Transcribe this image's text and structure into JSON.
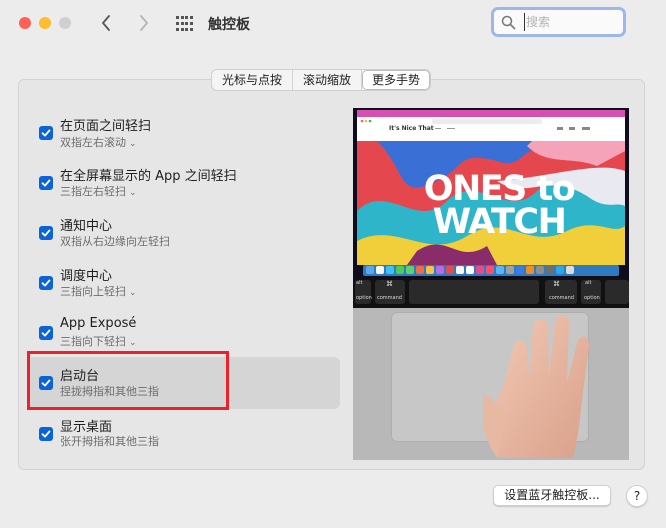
{
  "window": {
    "title": "触控板",
    "back_icon": "chevron-left",
    "forward_icon": "chevron-right",
    "grid_icon": "show-all-grid"
  },
  "search": {
    "placeholder": "搜索",
    "value": ""
  },
  "tabs": [
    {
      "label": "光标与点按",
      "active": false
    },
    {
      "label": "滚动缩放",
      "active": false
    },
    {
      "label": "更多手势",
      "active": true
    }
  ],
  "options": [
    {
      "title": "在页面之间轻扫",
      "subtitle": "双指左右滚动",
      "checked": true,
      "has_menu": true,
      "selected": false
    },
    {
      "title": "在全屏幕显示的 App 之间轻扫",
      "subtitle": "三指左右轻扫",
      "checked": true,
      "has_menu": true,
      "selected": false
    },
    {
      "title": "通知中心",
      "subtitle": "双指从右边缘向左轻扫",
      "checked": true,
      "has_menu": false,
      "selected": false
    },
    {
      "title": "调度中心",
      "subtitle": "三指向上轻扫",
      "checked": true,
      "has_menu": true,
      "selected": false
    },
    {
      "title": "App Exposé",
      "subtitle": "三指向下轻扫",
      "checked": true,
      "has_menu": true,
      "selected": false
    },
    {
      "title": "启动台",
      "subtitle": "捏拢拇指和其他三指",
      "checked": true,
      "has_menu": false,
      "selected": true
    },
    {
      "title": "显示桌面",
      "subtitle": "张开拇指和其他三指",
      "checked": true,
      "has_menu": false,
      "selected": false
    }
  ],
  "preview": {
    "site_name": "It's Nice That",
    "headline_line1": "ONES to",
    "headline_line2": "WATCH",
    "keys": {
      "left_option": "alt",
      "left_option_label": "option",
      "left_command_symbol": "⌘",
      "left_command": "command",
      "right_command_symbol": "⌘",
      "right_command": "command",
      "right_option": "alt",
      "right_option_label": "option"
    }
  },
  "footer": {
    "setup_button": "设置蓝牙触控板...",
    "help_button": "?"
  },
  "colors": {
    "accent": "#0a64d8",
    "highlight": "#e8232b",
    "selected_row": "#d5d5d5"
  }
}
